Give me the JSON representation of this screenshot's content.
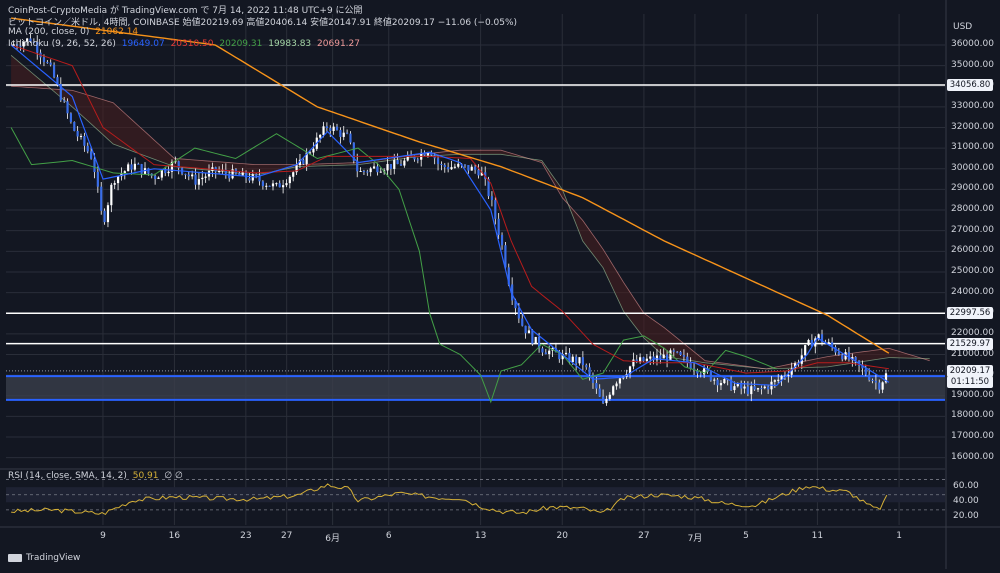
{
  "header": {
    "line1": "ビットコイン／米ドル, 4時間, COINBASE  始値20219.69  高値20406.14  安値20147.91  終値20209.17  −11.06 (−0.05%)",
    "top": "CoinPost-CryptoMedia が TradingView.com で 7月 14, 2022 11:48 UTC+9 に公開",
    "ma_label": "MA (200, close, 0)",
    "ma_value": "21062.14",
    "ichimoku_label": "Ichimoku (9, 26, 52, 26)",
    "ichimoku_values": [
      "19649.07",
      "20310.50",
      "20209.31",
      "19983.83",
      "20691.27"
    ],
    "rsi_label": "RSI (14, close, SMA, 14, 2)",
    "rsi_value": "50.91",
    "rsi_extra": "∅ ∅"
  },
  "colors": {
    "background": "#131722",
    "candle": "#ffffff",
    "ma": "#f7931a",
    "tenkan": "#2962ff",
    "kijun": "#b71c1c",
    "chikou": "#43a047",
    "span_a": "#a5d6a7",
    "span_b": "#ef9a9a",
    "rsi": "#d4af37",
    "support": "#2962ff",
    "resistance": "#ffffff"
  },
  "currency": "USD",
  "badges": {
    "r1": "34056.80",
    "r2": "22997.56",
    "r3": "21529.97",
    "current": "20209.17",
    "countdown": "01:11:50"
  },
  "footer": {
    "brand": "TradingView"
  },
  "chart_data": {
    "type": "line",
    "title": "ビットコイン／米ドル, 4時間, COINBASE",
    "ylabel": "USD",
    "ylim": [
      15500,
      37500
    ],
    "y_ticks": [
      "36000.00",
      "35000.00",
      "34000.00",
      "33000.00",
      "32000.00",
      "31000.00",
      "30000.00",
      "29000.00",
      "28000.00",
      "27000.00",
      "26000.00",
      "25000.00",
      "24000.00",
      "23000.00",
      "22000.00",
      "21000.00",
      "20000.00",
      "19000.00",
      "18000.00",
      "17000.00",
      "16000.00"
    ],
    "x_ticks": [
      "9",
      "16",
      "23",
      "27",
      "6月",
      "6",
      "13",
      "20",
      "27",
      "7月",
      "5",
      "11",
      "1"
    ],
    "close_anchors": [
      [
        0,
        36000
      ],
      [
        2,
        36300
      ],
      [
        4,
        34700
      ],
      [
        6,
        32000
      ],
      [
        8,
        30500
      ],
      [
        9,
        27300
      ],
      [
        10,
        29500
      ],
      [
        12,
        30200
      ],
      [
        14,
        29600
      ],
      [
        16,
        30300
      ],
      [
        18,
        29400
      ],
      [
        20,
        29900
      ],
      [
        22,
        29700
      ],
      [
        24,
        29500
      ],
      [
        26,
        29100
      ],
      [
        28,
        30000
      ],
      [
        31,
        32100
      ],
      [
        33,
        31500
      ],
      [
        34,
        29800
      ],
      [
        36,
        30100
      ],
      [
        38,
        30200
      ],
      [
        40,
        30700
      ],
      [
        41,
        31000
      ],
      [
        42,
        30100
      ],
      [
        44,
        30100
      ],
      [
        46,
        29900
      ],
      [
        47,
        28500
      ],
      [
        48,
        26500
      ],
      [
        49,
        24000
      ],
      [
        50,
        22500
      ],
      [
        51,
        21800
      ],
      [
        52,
        21300
      ],
      [
        54,
        20900
      ],
      [
        56,
        20600
      ],
      [
        57,
        19600
      ],
      [
        58,
        18500
      ],
      [
        59,
        19600
      ],
      [
        61,
        20600
      ],
      [
        63,
        20800
      ],
      [
        65,
        21000
      ],
      [
        67,
        20400
      ],
      [
        69,
        19800
      ],
      [
        71,
        19400
      ],
      [
        73,
        19200
      ],
      [
        75,
        19700
      ],
      [
        77,
        20600
      ],
      [
        78,
        21400
      ],
      [
        79,
        21900
      ],
      [
        80,
        21500
      ],
      [
        82,
        20800
      ],
      [
        84,
        20000
      ],
      [
        85,
        19500
      ],
      [
        86,
        20209
      ]
    ],
    "ma200_anchors": [
      [
        0,
        37300
      ],
      [
        20,
        36000
      ],
      [
        30,
        33000
      ],
      [
        40,
        31300
      ],
      [
        48,
        30100
      ],
      [
        56,
        28600
      ],
      [
        64,
        26500
      ],
      [
        72,
        24700
      ],
      [
        80,
        22900
      ],
      [
        86,
        21062
      ]
    ],
    "tenkan_anchors": [
      [
        0,
        36000
      ],
      [
        6,
        33500
      ],
      [
        9,
        29500
      ],
      [
        14,
        30000
      ],
      [
        24,
        29600
      ],
      [
        28,
        30200
      ],
      [
        31,
        31800
      ],
      [
        34,
        30300
      ],
      [
        41,
        30800
      ],
      [
        44,
        30300
      ],
      [
        47,
        28000
      ],
      [
        49,
        24000
      ],
      [
        51,
        22200
      ],
      [
        54,
        21000
      ],
      [
        57,
        19800
      ],
      [
        60,
        19900
      ],
      [
        63,
        20800
      ],
      [
        67,
        20600
      ],
      [
        71,
        19600
      ],
      [
        75,
        19500
      ],
      [
        78,
        21000
      ],
      [
        79,
        21800
      ],
      [
        82,
        20900
      ],
      [
        86,
        19649
      ]
    ],
    "kijun_anchors": [
      [
        0,
        36000
      ],
      [
        6,
        35000
      ],
      [
        9,
        32000
      ],
      [
        14,
        30200
      ],
      [
        24,
        29800
      ],
      [
        28,
        29900
      ],
      [
        31,
        30600
      ],
      [
        34,
        30600
      ],
      [
        41,
        30600
      ],
      [
        45,
        30500
      ],
      [
        47,
        29300
      ],
      [
        49,
        26500
      ],
      [
        51,
        24300
      ],
      [
        54,
        23100
      ],
      [
        57,
        21500
      ],
      [
        60,
        20700
      ],
      [
        63,
        20600
      ],
      [
        67,
        20600
      ],
      [
        72,
        20100
      ],
      [
        76,
        20200
      ],
      [
        79,
        20600
      ],
      [
        82,
        20600
      ],
      [
        86,
        20310
      ]
    ],
    "chikou_anchors": [
      [
        0,
        32000
      ],
      [
        2,
        30200
      ],
      [
        6,
        30400
      ],
      [
        10,
        29800
      ],
      [
        14,
        29700
      ],
      [
        18,
        31000
      ],
      [
        22,
        30500
      ],
      [
        26,
        31700
      ],
      [
        30,
        30500
      ],
      [
        34,
        31000
      ],
      [
        36,
        30200
      ],
      [
        38,
        29000
      ],
      [
        40,
        26000
      ],
      [
        41,
        23000
      ],
      [
        42,
        21500
      ],
      [
        44,
        21000
      ],
      [
        46,
        20000
      ],
      [
        47,
        18700
      ],
      [
        48,
        20200
      ],
      [
        50,
        20500
      ],
      [
        52,
        21500
      ],
      [
        54,
        21000
      ],
      [
        56,
        19800
      ],
      [
        58,
        20100
      ],
      [
        60,
        21700
      ],
      [
        62,
        21900
      ],
      [
        64,
        21300
      ],
      [
        66,
        20400
      ],
      [
        68,
        20100
      ],
      [
        70,
        21200
      ],
      [
        72,
        20900
      ],
      [
        74,
        20500
      ],
      [
        75,
        20300
      ]
    ],
    "span_a_anchors": [
      [
        0,
        35500
      ],
      [
        6,
        33000
      ],
      [
        10,
        31200
      ],
      [
        16,
        30100
      ],
      [
        24,
        29700
      ],
      [
        28,
        30100
      ],
      [
        34,
        30200
      ],
      [
        40,
        30600
      ],
      [
        44,
        30700
      ],
      [
        48,
        30700
      ],
      [
        52,
        30400
      ],
      [
        54,
        29000
      ],
      [
        56,
        26500
      ],
      [
        58,
        25200
      ],
      [
        60,
        23100
      ],
      [
        62,
        21800
      ],
      [
        64,
        20900
      ],
      [
        68,
        20600
      ],
      [
        74,
        20300
      ],
      [
        80,
        20400
      ],
      [
        86,
        20850
      ],
      [
        90,
        20800
      ]
    ],
    "span_b_anchors": [
      [
        0,
        34000
      ],
      [
        6,
        33800
      ],
      [
        10,
        33200
      ],
      [
        16,
        30500
      ],
      [
        24,
        30200
      ],
      [
        28,
        30200
      ],
      [
        34,
        30300
      ],
      [
        40,
        30700
      ],
      [
        44,
        30900
      ],
      [
        48,
        30900
      ],
      [
        52,
        30300
      ],
      [
        54,
        28600
      ],
      [
        56,
        27500
      ],
      [
        58,
        26100
      ],
      [
        60,
        24500
      ],
      [
        62,
        23000
      ],
      [
        64,
        22300
      ],
      [
        68,
        20700
      ],
      [
        74,
        20300
      ],
      [
        80,
        20900
      ],
      [
        86,
        21300
      ],
      [
        90,
        20700
      ]
    ],
    "support_levels": [
      18800,
      19950
    ],
    "resistance_levels": [
      34056.8,
      22997.56,
      21529.97
    ],
    "current_price": 20209.17,
    "rsi": {
      "ylim": [
        10,
        80
      ],
      "y_ticks": [
        "60.00",
        "40.00",
        "20.00"
      ],
      "anchors": [
        [
          0,
          28
        ],
        [
          4,
          30
        ],
        [
          9,
          25
        ],
        [
          12,
          43
        ],
        [
          16,
          47
        ],
        [
          20,
          45
        ],
        [
          24,
          44
        ],
        [
          28,
          49
        ],
        [
          31,
          63
        ],
        [
          33,
          58
        ],
        [
          34,
          42
        ],
        [
          38,
          52
        ],
        [
          42,
          46
        ],
        [
          44,
          46
        ],
        [
          46,
          35
        ],
        [
          48,
          28
        ],
        [
          50,
          26
        ],
        [
          53,
          34
        ],
        [
          56,
          32
        ],
        [
          58,
          25
        ],
        [
          60,
          45
        ],
        [
          63,
          50
        ],
        [
          66,
          48
        ],
        [
          68,
          44
        ],
        [
          70,
          38
        ],
        [
          73,
          36
        ],
        [
          75,
          47
        ],
        [
          78,
          62
        ],
        [
          80,
          57
        ],
        [
          82,
          54
        ],
        [
          84,
          36
        ],
        [
          85,
          30
        ],
        [
          86,
          51
        ]
      ]
    }
  }
}
